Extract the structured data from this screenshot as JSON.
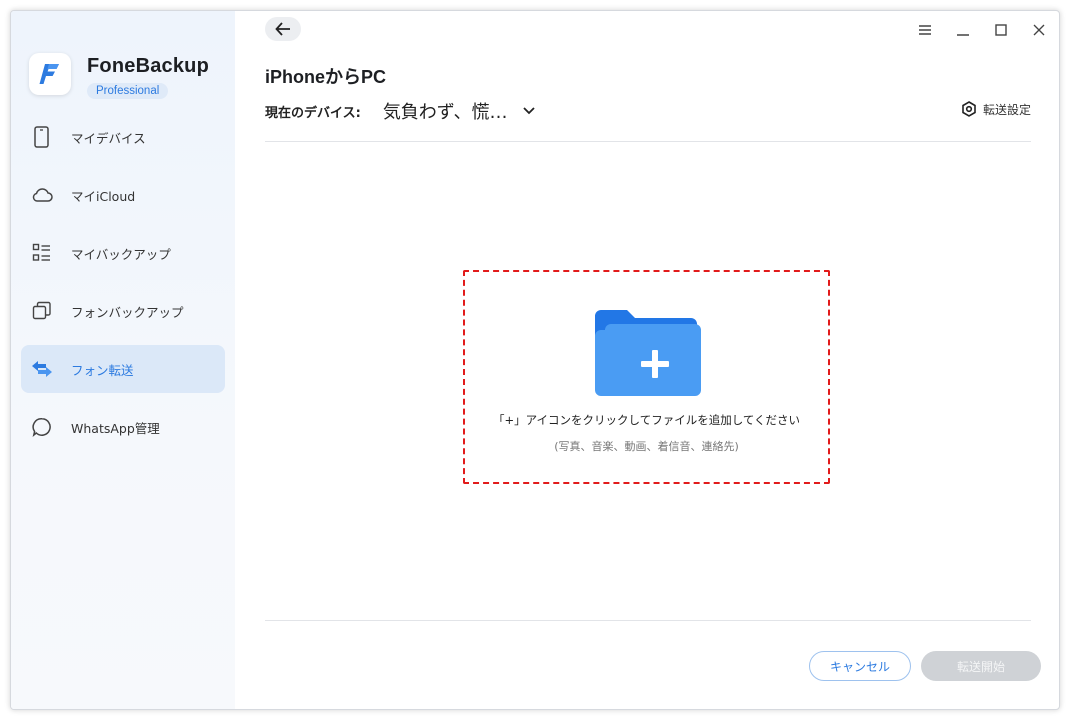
{
  "app": {
    "name": "FoneBackup",
    "edition": "Professional",
    "accent_color": "#2d7be0"
  },
  "sidebar": {
    "items": [
      {
        "label": "マイデバイス",
        "icon": "phone-icon",
        "active": false
      },
      {
        "label": "マイiCloud",
        "icon": "cloud-icon",
        "active": false
      },
      {
        "label": "マイバックアップ",
        "icon": "list-icon",
        "active": false
      },
      {
        "label": "フォンバックアップ",
        "icon": "copy-icon",
        "active": false
      },
      {
        "label": "フォン転送",
        "icon": "transfer-arrows-icon",
        "active": true
      },
      {
        "label": "WhatsApp管理",
        "icon": "chat-bubble-icon",
        "active": false
      }
    ]
  },
  "window_controls": [
    "menu-icon",
    "minimize-icon",
    "maximize-icon",
    "close-icon"
  ],
  "main": {
    "title": "iPhoneからPC",
    "device_label": "現在のデバイス:",
    "device_value": "気負わず、慌…",
    "settings_label": "転送設定",
    "dropzone": {
      "main_text": "「+」アイコンをクリックしてファイルを追加してください",
      "sub_text": "(写真、音楽、動画、着信音、連絡先)",
      "border_color": "#e21b1b"
    },
    "cancel_label": "キャンセル",
    "start_label": "転送開始"
  }
}
